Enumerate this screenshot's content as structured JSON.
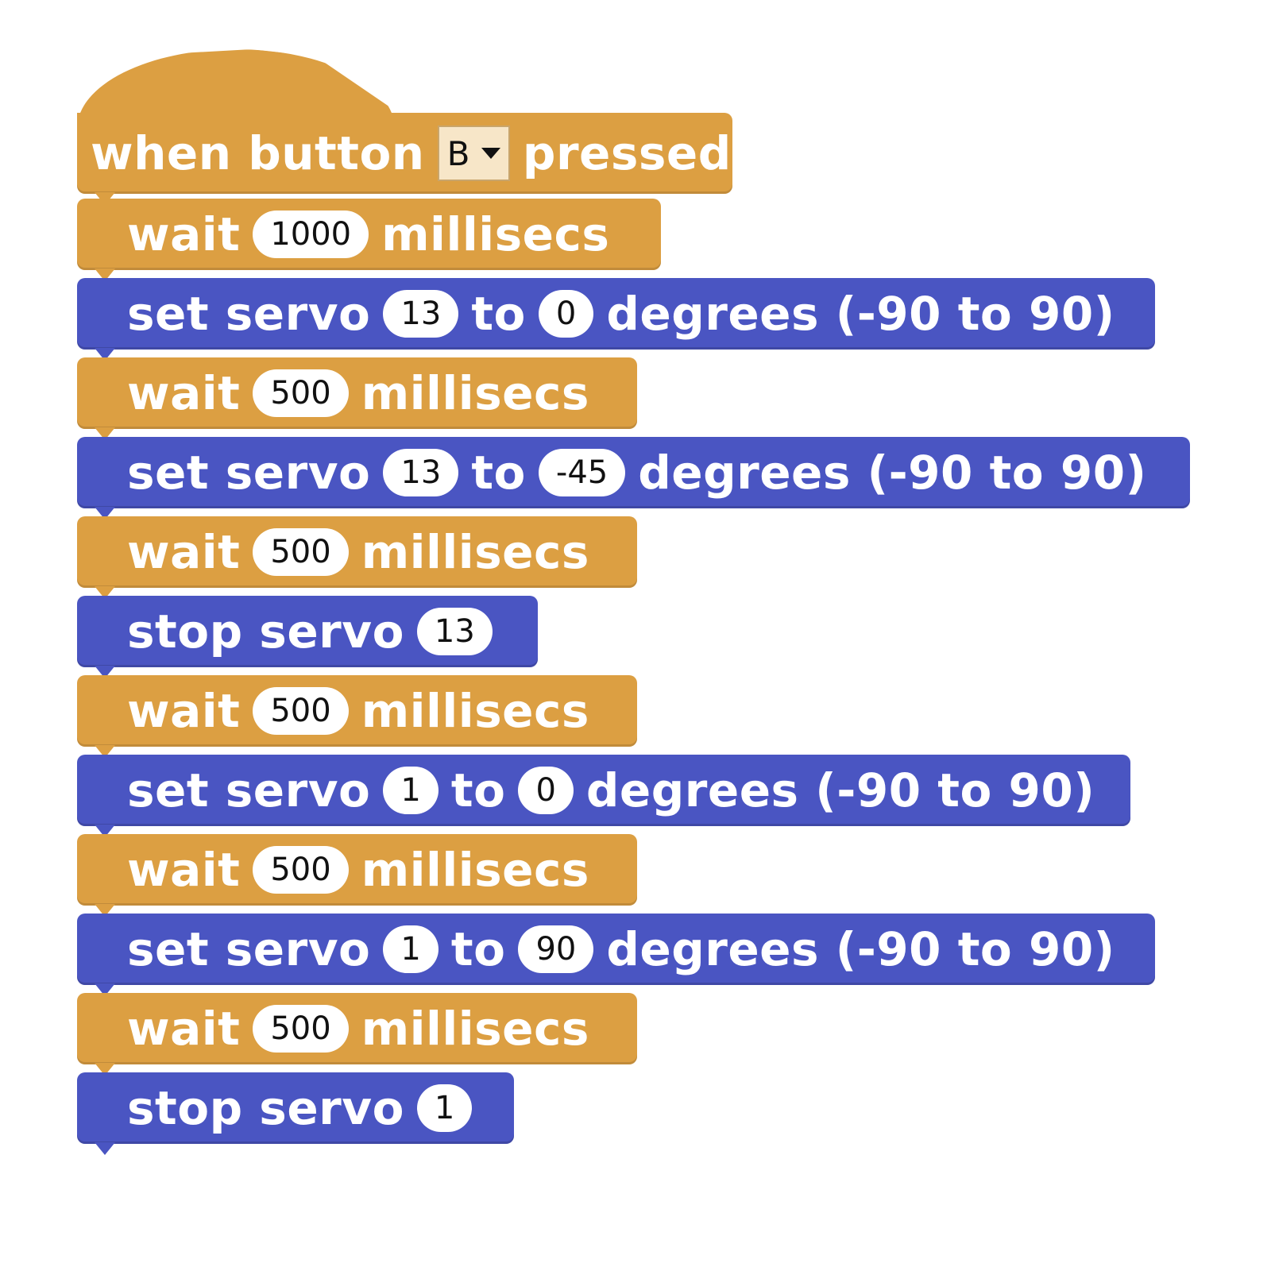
{
  "hat_block": {
    "prefix": "when button",
    "button_value": "B",
    "suffix": "pressed"
  },
  "blocks": [
    {
      "type": "wait",
      "label_a": "wait",
      "value": "1000",
      "label_b": "millisecs"
    },
    {
      "type": "set_servo",
      "label_a": "set servo",
      "pin": "13",
      "label_to": "to",
      "degrees": "0",
      "label_b": "degrees (-90 to 90)"
    },
    {
      "type": "wait",
      "label_a": "wait",
      "value": "500",
      "label_b": "millisecs"
    },
    {
      "type": "set_servo",
      "label_a": "set servo",
      "pin": "13",
      "label_to": "to",
      "degrees": "-45",
      "label_b": "degrees (-90 to 90)"
    },
    {
      "type": "wait",
      "label_a": "wait",
      "value": "500",
      "label_b": "millisecs"
    },
    {
      "type": "stop_servo",
      "label_a": "stop servo",
      "pin": "13"
    },
    {
      "type": "wait",
      "label_a": "wait",
      "value": "500",
      "label_b": "millisecs"
    },
    {
      "type": "set_servo",
      "label_a": "set servo",
      "pin": "1",
      "label_to": "to",
      "degrees": "0",
      "label_b": "degrees (-90 to 90)"
    },
    {
      "type": "wait",
      "label_a": "wait",
      "value": "500",
      "label_b": "millisecs"
    },
    {
      "type": "set_servo",
      "label_a": "set servo",
      "pin": "1",
      "label_to": "to",
      "degrees": "90",
      "label_b": "degrees (-90 to 90)"
    },
    {
      "type": "wait",
      "label_a": "wait",
      "value": "500",
      "label_b": "millisecs"
    },
    {
      "type": "stop_servo",
      "label_a": "stop servo",
      "pin": "1"
    }
  ],
  "colors": {
    "control": "#dc9f42",
    "servo": "#4a55c2"
  }
}
